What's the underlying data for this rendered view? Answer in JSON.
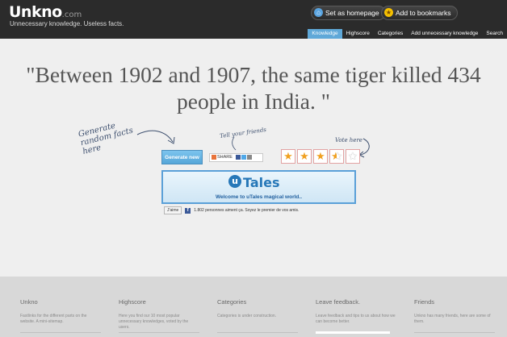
{
  "header": {
    "logo": "Unkno",
    "logo_suffix": ".com",
    "tagline": "Unnecessary knowledge. Useless facts.",
    "homepage_label": "Set as homepage",
    "bookmarks_label": "Add to bookmarks",
    "tabs": [
      {
        "label": "Knowledge",
        "active": true
      },
      {
        "label": "Highscore",
        "active": false
      },
      {
        "label": "Categories",
        "active": false
      },
      {
        "label": "Add unnecessary knowledge",
        "active": false
      },
      {
        "label": "Search",
        "active": false
      }
    ]
  },
  "fact": {
    "text": "\"Between 1902 and 1907, the same tiger killed 434 people in India. \""
  },
  "notes": {
    "generate": "Generate random facts here",
    "tell": "Tell your friends",
    "vote": "Vote here"
  },
  "controls": {
    "generate_label": "Generate new",
    "share_label": "SHARE",
    "rating": 3.5,
    "max_rating": 5
  },
  "banner": {
    "logo": "Tales",
    "logo_letter": "u",
    "subtitle": "Welcome to uTales magical world.."
  },
  "facebook": {
    "like_label": "J'aime",
    "icon": "f",
    "count_text": "1.802 personnes aiment ça. Soyez le premier de vos amis."
  },
  "footer": {
    "columns": [
      {
        "title": "Unkno",
        "text": "Fastlinks for the different parts on the website. A mini-sitemap."
      },
      {
        "title": "Highscore",
        "text": "Here you find our 10 most popular unnecessary knowledges, voted by the users."
      },
      {
        "title": "Categories",
        "text": "Categories is under construction."
      },
      {
        "title": "Leave feedback.",
        "text": "Leave feedback and tips to us about how we can become better."
      },
      {
        "title": "Friends",
        "text": "Unkno has many friends, here are some of them."
      }
    ]
  },
  "colors": {
    "header_bg": "#2b2b2b",
    "active_tab": "#5fa8d8",
    "star": "#f0a020",
    "brand_blue": "#2778b8"
  }
}
